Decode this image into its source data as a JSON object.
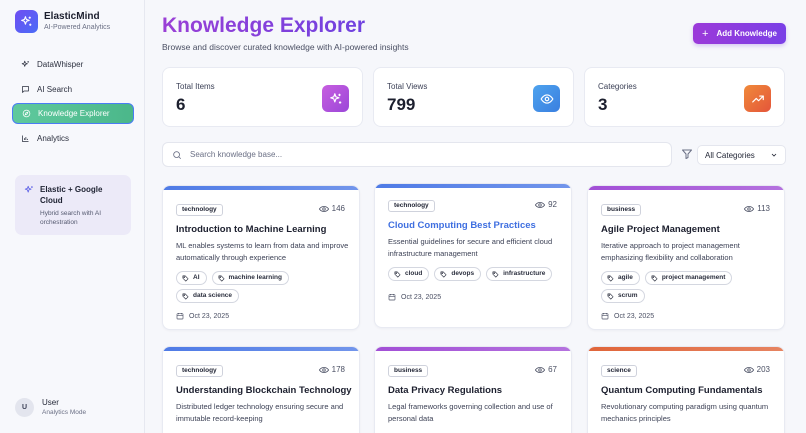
{
  "brand": {
    "name": "ElasticMind",
    "subtitle": "AI-Powered Analytics"
  },
  "nav": [
    {
      "label": "DataWhisper",
      "icon": "sparkle-icon"
    },
    {
      "label": "AI Search",
      "icon": "chat-icon"
    },
    {
      "label": "Knowledge Explorer",
      "icon": "compass-icon",
      "active": true
    },
    {
      "label": "Analytics",
      "icon": "bar-chart-icon"
    }
  ],
  "promo": {
    "title": "Elastic + Google Cloud",
    "description": "Hybrid search with AI orchestration"
  },
  "user": {
    "initial": "U",
    "name": "User",
    "role": "Analytics Mode"
  },
  "header": {
    "title": "Knowledge Explorer",
    "subtitle": "Browse and discover curated knowledge with AI-powered insights",
    "add_label": "Add Knowledge"
  },
  "stats": [
    {
      "label": "Total Items",
      "value": "6",
      "icon": "sparkle-icon",
      "color": "#b553d8"
    },
    {
      "label": "Total Views",
      "value": "799",
      "icon": "eye-icon",
      "color": "#3f8ee8"
    },
    {
      "label": "Categories",
      "value": "3",
      "icon": "trending-up-icon",
      "color": "#ec6b3b"
    }
  ],
  "search": {
    "placeholder": "Search knowledge base...",
    "filter_value": "All Categories"
  },
  "cards": [
    {
      "category": "technology",
      "views": "146",
      "title": "Introduction to Machine Learning",
      "description": "ML enables systems to learn from data and improve automatically through experience",
      "tags": [
        "AI",
        "machine learning",
        "data science"
      ],
      "date": "Oct 23, 2025",
      "accent": "#4f7be6"
    },
    {
      "category": "technology",
      "views": "92",
      "title": "Cloud Computing Best Practices",
      "description": "Essential guidelines for secure and efficient cloud infrastructure management",
      "tags": [
        "cloud",
        "devops",
        "infrastructure"
      ],
      "date": "Oct 23, 2025",
      "accent": "#4f7be6"
    },
    {
      "category": "business",
      "views": "113",
      "title": "Agile Project Management",
      "description": "Iterative approach to project management emphasizing flexibility and collaboration",
      "tags": [
        "agile",
        "project management",
        "scrum"
      ],
      "date": "Oct 23, 2025",
      "accent": "#a24fd6"
    },
    {
      "category": "technology",
      "views": "178",
      "title": "Understanding Blockchain Technology",
      "description": "Distributed ledger technology ensuring secure and immutable record-keeping",
      "tags": [],
      "date": "",
      "accent": "#4f7be6"
    },
    {
      "category": "business",
      "views": "67",
      "title": "Data Privacy Regulations",
      "description": "Legal frameworks governing collection and use of personal data",
      "tags": [],
      "date": "",
      "accent": "#a24fd6"
    },
    {
      "category": "science",
      "views": "203",
      "title": "Quantum Computing Fundamentals",
      "description": "Revolutionary computing paradigm using quantum mechanics principles",
      "tags": [],
      "date": "",
      "accent": "#e0653a"
    }
  ]
}
